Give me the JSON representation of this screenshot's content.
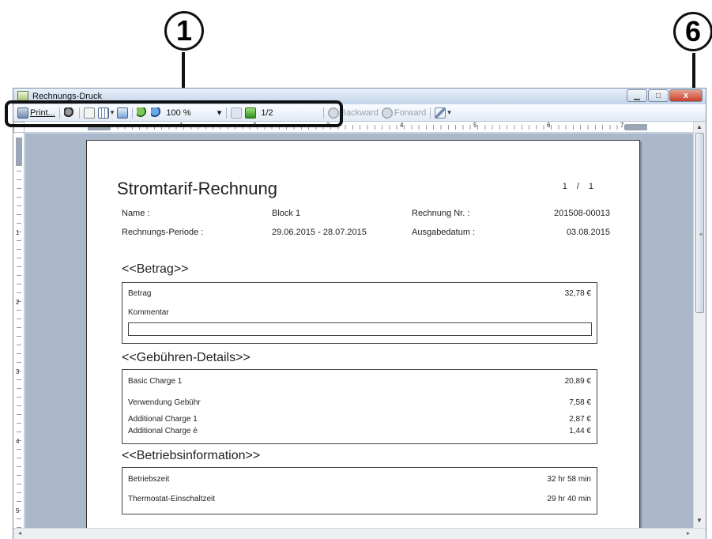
{
  "callouts": {
    "left": "1",
    "right": "6"
  },
  "window": {
    "title": "Rechnungs-Druck",
    "minimize": "▁",
    "maximize": "□",
    "close": "x"
  },
  "toolbar": {
    "print_label": "Print...",
    "zoom_value": "100 %",
    "zoom_dropdown": "▾",
    "page_indicator": "1/2",
    "backward_label": "Backward",
    "forward_label": "Forward",
    "icons": [
      "printer-icon",
      "binoculars-icon",
      "single-page-icon",
      "multi-page-icon",
      "page-layout-icon",
      "zoom-in-icon",
      "zoom-out-icon",
      "previous-page-icon",
      "next-page-icon",
      "backward-icon",
      "forward-icon",
      "edit-icon"
    ]
  },
  "ruler": {
    "h_numbers": [
      "1",
      "2",
      "3",
      "4",
      "5",
      "6",
      "7"
    ],
    "v_numbers": [
      "1",
      "2",
      "3",
      "4",
      "5"
    ]
  },
  "document": {
    "title": "Stromtarif-Rechnung",
    "page_current": "1",
    "page_sep": "/",
    "page_total": "1",
    "info": {
      "name_label": "Name :",
      "name_value": "Block 1",
      "invoice_no_label": "Rechnung Nr. :",
      "invoice_no_value": "201508-00013",
      "period_label": "Rechnungs-Periode :",
      "period_value": "29.06.2015 - 28.07.2015",
      "issue_date_label": "Ausgabedatum :",
      "issue_date_value": "03.08.2015"
    },
    "betrag": {
      "heading": "<<Betrag>>",
      "amount_label": "Betrag",
      "amount_value": "32,78 €",
      "comment_label": "Kommentar"
    },
    "gebuehren": {
      "heading": "<<Gebühren-Details>>",
      "rows": [
        {
          "label": "Basic Charge 1",
          "value": "20,89 €"
        },
        {
          "label": "Verwendung Gebühr",
          "value": "7,58 €"
        },
        {
          "label": "Additional Charge 1",
          "value": "2,87 €"
        },
        {
          "label": "Additional Charge é",
          "value": "1,44 €"
        }
      ]
    },
    "betrieb": {
      "heading": "<<Betriebsinformation>>",
      "rows": [
        {
          "label": "Betriebszeit",
          "value": "32 hr 58 min"
        },
        {
          "label": "Thermostat-Einschaltzeit",
          "value": "29 hr 40 min"
        }
      ]
    }
  },
  "scroll": {
    "up": "▲",
    "down": "▼",
    "left": "◂",
    "right": "▸",
    "grip": "≡"
  }
}
